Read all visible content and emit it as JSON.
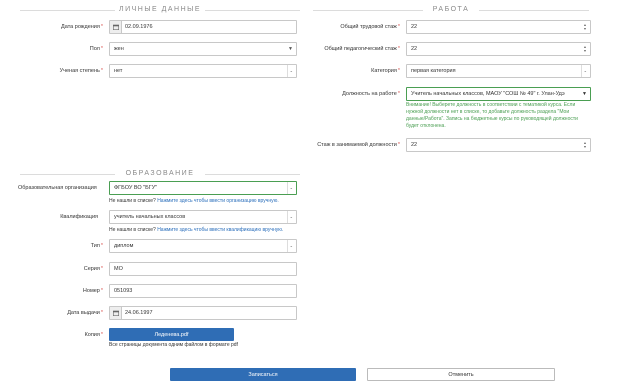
{
  "personal": {
    "section_title": "ЛИЧНЫЕ ДАННЫЕ",
    "birth_date": {
      "label": "Дата рождения",
      "value": "02.09.1976"
    },
    "gender": {
      "label": "Пол",
      "value": "жен"
    },
    "degree": {
      "label": "Ученая степень",
      "value": "нет"
    }
  },
  "work": {
    "section_title": "РАБОТА",
    "total_exp": {
      "label": "Общий трудовой стаж",
      "value": "22"
    },
    "ped_exp": {
      "label": "Общий педагогический стаж",
      "value": "22"
    },
    "category": {
      "label": "Категория",
      "value": "первая категория"
    },
    "position": {
      "label": "Должность на работе",
      "value": "Учитель начальных классов, МАОУ \"СОШ № 49\" г. Улан-Удэ",
      "warning": "Внимание! Выберете должность в соответствии с тематикой курса. Если нужной должности нет в списке, то добавьте должность раздела \"Мои данные/Работа\". Запись на бюджетные курсы по руководящей должности будет отклонена."
    },
    "position_exp": {
      "label": "Стаж в занимаемой должности",
      "value": "22"
    }
  },
  "education": {
    "section_title": "ОБРАЗОВАНИЕ",
    "org": {
      "label": "Образовательная организация",
      "value": "ФГБОУ ВО \"БГУ\"",
      "hint_prefix": "Не нашли в списке?",
      "hint_link": "Нажмите здесь чтобы ввести организацию вручную."
    },
    "qualification": {
      "label": "Квалификация",
      "value": "учитель начальных классов",
      "hint_prefix": "Не нашли в списке?",
      "hint_link": "Нажмите здесь чтобы ввести квалификацию вручную."
    },
    "type": {
      "label": "Тип",
      "value": "диплом"
    },
    "series": {
      "label": "Серия",
      "value": "МО"
    },
    "number": {
      "label": "Номер",
      "value": "051093"
    },
    "issue_date": {
      "label": "Дата выдачи",
      "value": "24.06.1997"
    },
    "copy": {
      "label": "Копия",
      "file_button": "Леденева.pdf",
      "hint": "Все страницы документа одним файлом в формате pdf"
    }
  },
  "actions": {
    "submit": "Записаться",
    "cancel": "Отменить"
  },
  "colors": {
    "primary": "#2f6db5",
    "required": "#d9534f",
    "valid": "#4a9e52",
    "link": "#2a6ebb"
  }
}
